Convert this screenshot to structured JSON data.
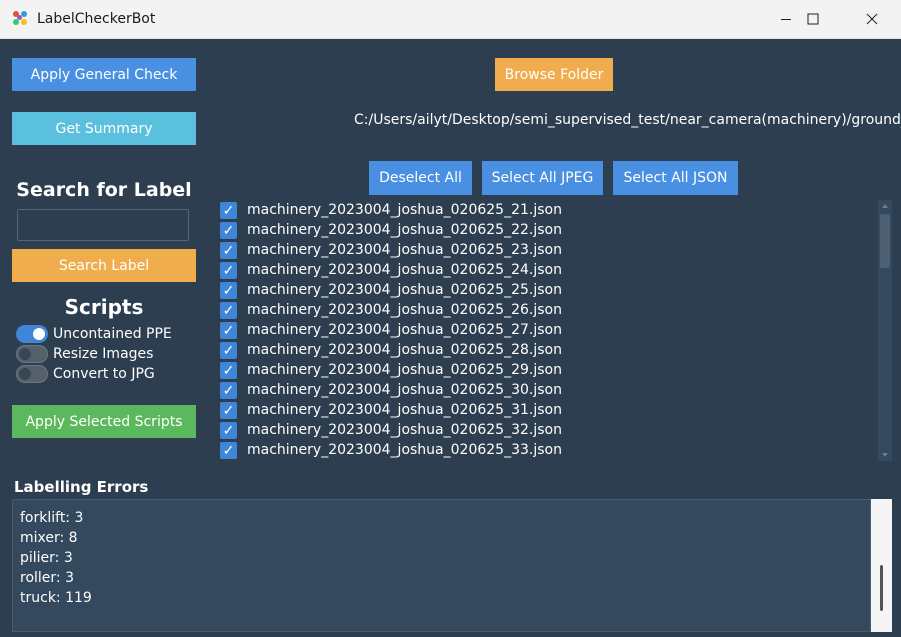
{
  "window": {
    "title": "LabelCheckerBot",
    "controls": [
      "minimize",
      "maximize",
      "close"
    ]
  },
  "left_panel": {
    "apply_general_check": "Apply General Check",
    "get_summary": "Get Summary",
    "search_heading": "Search for Label",
    "search_value": "",
    "search_button": "Search Label",
    "scripts_heading": "Scripts",
    "scripts": [
      {
        "label": "Uncontained PPE",
        "enabled": true
      },
      {
        "label": "Resize Images",
        "enabled": false
      },
      {
        "label": "Convert to JPG",
        "enabled": false
      }
    ],
    "apply_scripts": "Apply Selected Scripts"
  },
  "right_panel": {
    "browse_folder": "Browse Folder",
    "folder_path": "C:/Users/ailyt/Desktop/semi_supervised_test/near_camera(machinery)/ground_truth",
    "deselect_all": "Deselect All",
    "select_jpeg": "Select All JPEG",
    "select_json": "Select All JSON",
    "files": [
      {
        "name": "machinery_2023004_joshua_020625_21.json",
        "checked": true
      },
      {
        "name": "machinery_2023004_joshua_020625_22.json",
        "checked": true
      },
      {
        "name": "machinery_2023004_joshua_020625_23.json",
        "checked": true
      },
      {
        "name": "machinery_2023004_joshua_020625_24.json",
        "checked": true
      },
      {
        "name": "machinery_2023004_joshua_020625_25.json",
        "checked": true
      },
      {
        "name": "machinery_2023004_joshua_020625_26.json",
        "checked": true
      },
      {
        "name": "machinery_2023004_joshua_020625_27.json",
        "checked": true
      },
      {
        "name": "machinery_2023004_joshua_020625_28.json",
        "checked": true
      },
      {
        "name": "machinery_2023004_joshua_020625_29.json",
        "checked": true
      },
      {
        "name": "machinery_2023004_joshua_020625_30.json",
        "checked": true
      },
      {
        "name": "machinery_2023004_joshua_020625_31.json",
        "checked": true
      },
      {
        "name": "machinery_2023004_joshua_020625_32.json",
        "checked": true
      },
      {
        "name": "machinery_2023004_joshua_020625_33.json",
        "checked": true
      }
    ]
  },
  "errors": {
    "heading": "Labelling Errors",
    "lines": [
      "forklift: 3",
      "mixer: 8",
      "pilier: 3",
      "roller: 3",
      "truck: 119"
    ]
  },
  "colors": {
    "background": "#2c3e50",
    "blue_button": "#4a90e2",
    "cyan_button": "#5bc0de",
    "orange_button": "#f0ad4e",
    "green_button": "#5cb85c"
  }
}
